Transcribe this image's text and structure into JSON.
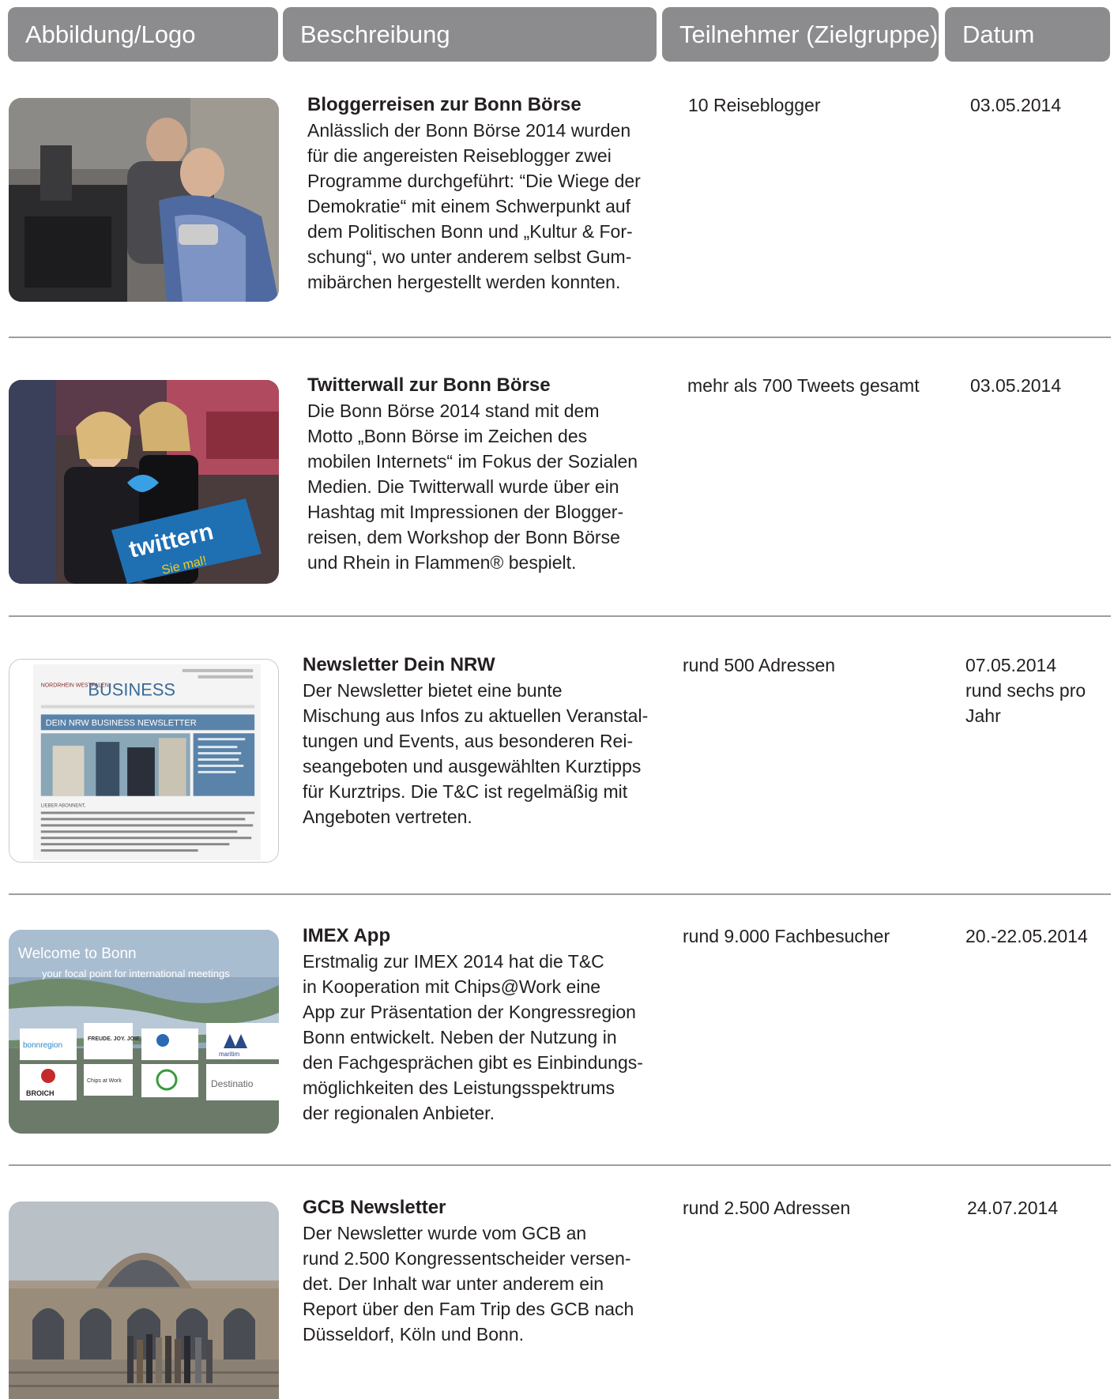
{
  "header": {
    "col_image": "Abbildung/Logo",
    "col_description": "Beschreibung",
    "col_participants": "Teilnehmer (Zielgruppe)",
    "col_date": "Datum"
  },
  "rows": [
    {
      "title": "Bloggerreisen zur Bonn Börse",
      "lines": [
        "Anlässlich der Bonn Börse 2014 wurden",
        "für die angereisten Reiseblogger zwei",
        "Programme durchgeführt: “Die Wiege der",
        "Demokratie“ mit einem Schwerpunkt auf",
        "dem Politischen Bonn und „Kultur & For-",
        "schung“, wo unter anderem selbst Gum-",
        "mibärchen hergestellt werden konnten."
      ],
      "participants": "10 Reiseblogger",
      "date_lines": [
        "03.05.2014"
      ]
    },
    {
      "title": "Twitterwall zur Bonn Börse",
      "lines": [
        "Die Bonn Börse 2014 stand mit dem",
        "Motto „Bonn Börse im Zeichen des",
        "mobilen Internets“ im Fokus der Sozialen",
        "Medien. Die Twitterwall wurde über ein",
        "Hashtag mit Impressionen der Blogger-",
        "reisen, dem Workshop der Bonn Börse",
        "und Rhein in Flammen® bespielt."
      ],
      "participants": "mehr als 700 Tweets gesamt",
      "date_lines": [
        "03.05.2014"
      ],
      "image_texts": [
        "twittern",
        "Sie mal!"
      ]
    },
    {
      "title": "Newsletter Dein NRW",
      "lines": [
        "Der Newsletter bietet eine bunte",
        "Mischung aus Infos zu aktuellen Veranstal-",
        "tungen und Events, aus besonderen Rei-",
        "seangeboten und ausgewählten Kurztipps",
        "für Kurztrips. Die T&C ist regelmäßig mit",
        "Angeboten vertreten."
      ],
      "participants": "rund 500 Adressen",
      "date_lines": [
        "07.05.2014",
        "rund sechs pro",
        "Jahr"
      ],
      "image_texts": [
        "NORDRHEIN WESTFALEN",
        "BUSINESS",
        "DEIN NRW BUSINESS NEWSLETTER",
        "LIEBER ABONNENT,"
      ]
    },
    {
      "title": "IMEX App",
      "lines": [
        "Erstmalig zur IMEX 2014 hat die T&C",
        "in Kooperation mit Chips@Work eine",
        "App zur Präsentation der Kongressregion",
        "Bonn entwickelt. Neben der Nutzung in",
        "den Fachgesprächen gibt es Einbindungs-",
        "möglichkeiten des Leistungsspektrums",
        "der regionalen Anbieter."
      ],
      "participants": "rund 9.000 Fachbesucher",
      "date_lines": [
        "20.-22.05.2014"
      ],
      "image_texts": [
        "Welcome to Bonn",
        "your focal point for international meetings",
        "bonnregion",
        "FREUDE. JOY. JOIE. BONN.",
        "maritim",
        "BROICH",
        "Chips at Work",
        "Destinatio"
      ]
    },
    {
      "title": "GCB Newsletter",
      "lines": [
        "Der Newsletter wurde vom GCB an",
        "rund 2.500 Kongressentscheider versen-",
        "det.  Der Inhalt war unter anderem ein",
        "Report über den Fam Trip des GCB nach",
        "Düsseldorf, Köln und Bonn."
      ],
      "participants": "rund 2.500 Adressen",
      "date_lines": [
        "24.07.2014"
      ]
    }
  ]
}
